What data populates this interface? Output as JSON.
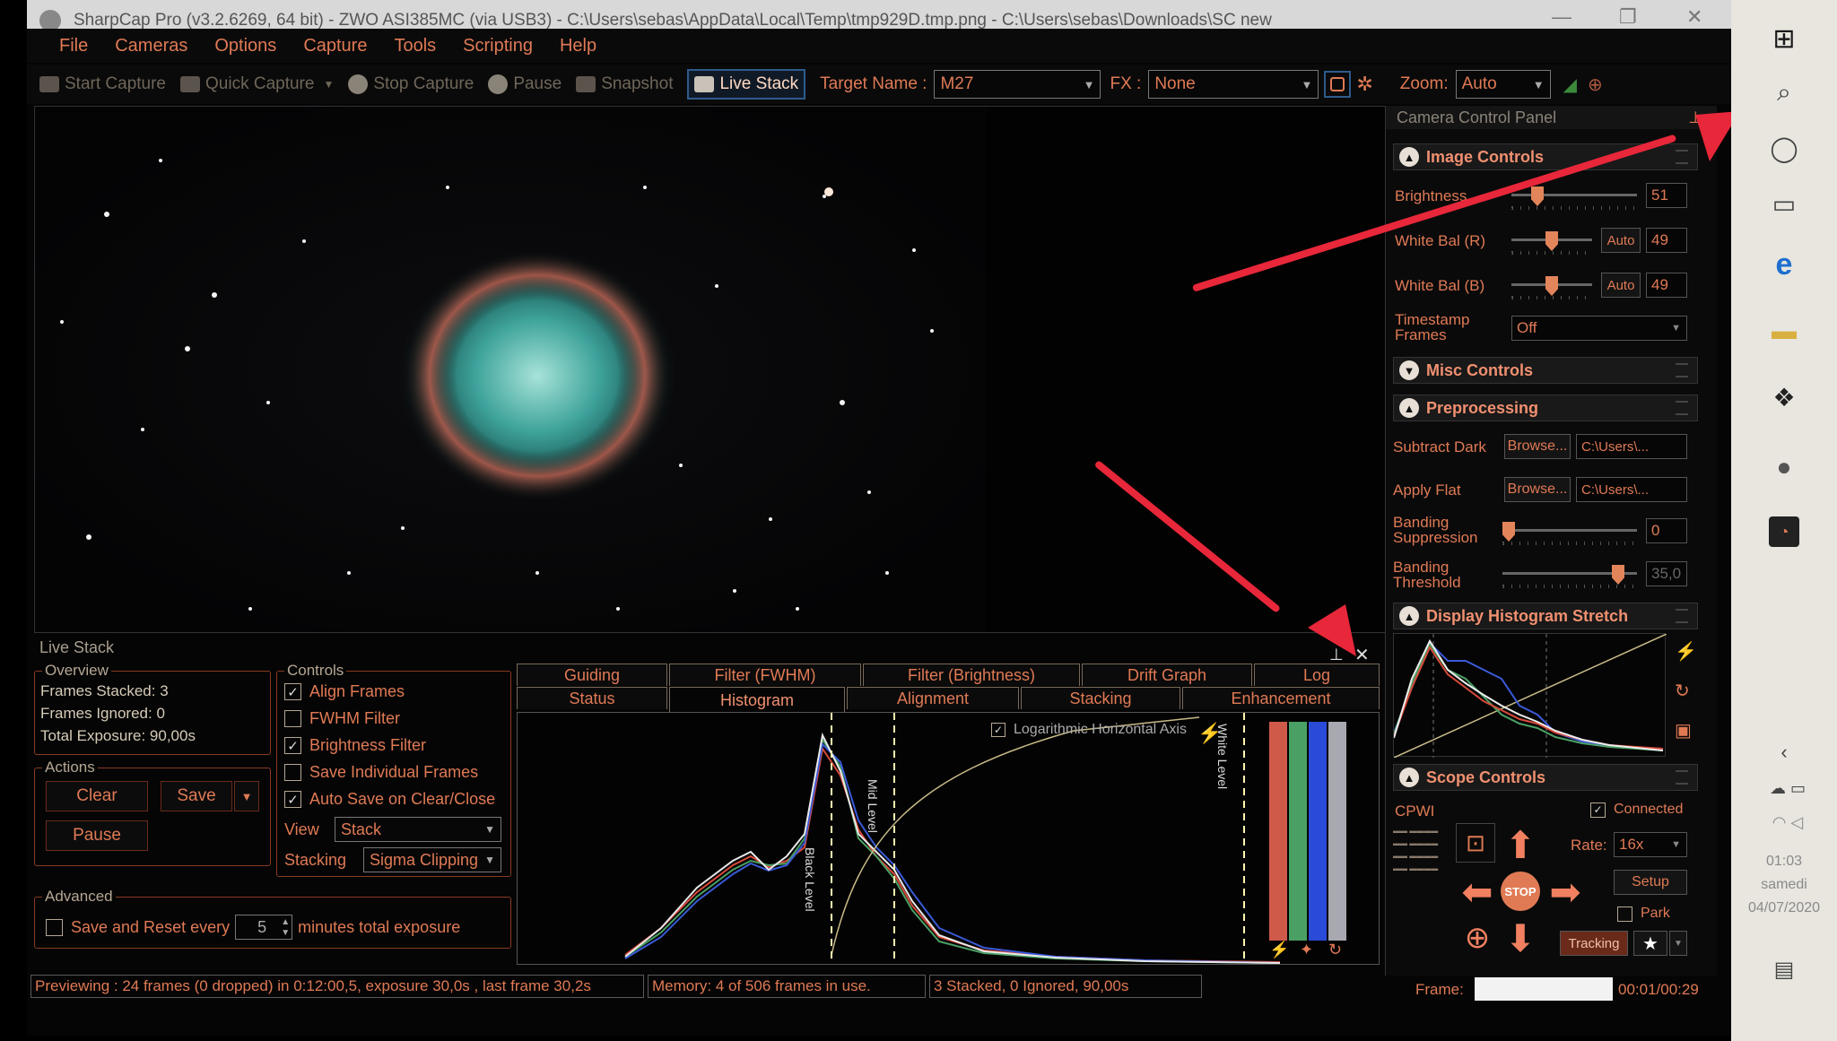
{
  "window": {
    "title": "SharpCap Pro (v3.2.6269, 64 bit) - ZWO ASI385MC (via USB3) - C:\\Users\\sebas\\AppData\\Local\\Temp\\tmp929D.tmp.png - C:\\Users\\sebas\\Downloads\\SC new"
  },
  "menu": [
    "File",
    "Cameras",
    "Options",
    "Capture",
    "Tools",
    "Scripting",
    "Help"
  ],
  "toolbar": {
    "start_capture": "Start Capture",
    "quick_capture": "Quick Capture",
    "stop_capture": "Stop Capture",
    "pause": "Pause",
    "snapshot": "Snapshot",
    "live_stack": "Live Stack",
    "target_label": "Target Name :",
    "target_value": "M27",
    "fx_label": "FX :",
    "fx_value": "None",
    "zoom_label": "Zoom:",
    "zoom_value": "Auto"
  },
  "live_stack": {
    "title": "Live Stack",
    "overview": {
      "label": "Overview",
      "rows": [
        {
          "label": "Frames Stacked:",
          "value": "3"
        },
        {
          "label": "Frames Ignored:",
          "value": "0"
        },
        {
          "label": "Total Exposure:",
          "value": "90,00s"
        }
      ]
    },
    "actions": {
      "label": "Actions",
      "clear": "Clear",
      "save": "Save",
      "pause": "Pause"
    },
    "controls": {
      "label": "Controls",
      "checks": [
        {
          "label": "Align Frames",
          "checked": true
        },
        {
          "label": "FWHM Filter",
          "checked": false
        },
        {
          "label": "Brightness Filter",
          "checked": true
        },
        {
          "label": "Save Individual Frames",
          "checked": false
        },
        {
          "label": "Auto Save on Clear/Close",
          "checked": true
        }
      ],
      "view_label": "View",
      "view_value": "Stack",
      "stacking_label": "Stacking",
      "stacking_value": "Sigma Clipping"
    },
    "advanced": {
      "label": "Advanced",
      "save_reset_label": "Save and Reset every",
      "minutes_value": "5",
      "minutes_suffix": "minutes total exposure"
    }
  },
  "tabs_row1": [
    "Guiding",
    "Filter (FWHM)",
    "Filter (Brightness)",
    "Drift Graph",
    "Log"
  ],
  "tabs_row2": [
    "Status",
    "Histogram",
    "Alignment",
    "Stacking",
    "Enhancement"
  ],
  "histogram": {
    "log_axis_label": "Logarithmic Horizontal Axis",
    "black_level": "Black Level",
    "mid_level": "Mid Level",
    "white_level": "White Level"
  },
  "camera_panel": {
    "title": "Camera Control Panel",
    "image_controls": {
      "title": "Image Controls",
      "brightness_label": "Brightness",
      "brightness_value": "51",
      "wb_r_label": "White Bal (R)",
      "wb_r_value": "49",
      "wb_b_label": "White Bal (B)",
      "wb_b_value": "49",
      "auto": "Auto",
      "timestamp_label": "Timestamp Frames",
      "timestamp_value": "Off"
    },
    "misc_controls": {
      "title": "Misc Controls"
    },
    "preprocessing": {
      "title": "Preprocessing",
      "subtract_dark_label": "Subtract Dark",
      "apply_flat_label": "Apply Flat",
      "browse": "Browse...",
      "path": "C:\\Users\\...",
      "banding_suppression_label": "Banding Suppression",
      "banding_suppression_value": "0",
      "banding_threshold_label": "Banding Threshold",
      "banding_threshold_value": "35,0"
    },
    "display_histogram": {
      "title": "Display Histogram Stretch"
    },
    "scope_controls": {
      "title": "Scope Controls",
      "mount": "CPWI",
      "connected": "Connected",
      "rate_label": "Rate:",
      "rate_value": "16x",
      "setup": "Setup",
      "park": "Park",
      "stop": "STOP",
      "tracking": "Tracking"
    }
  },
  "status_bar": {
    "previewing": "Previewing : 24 frames (0 dropped) in 0:12:00,5, exposure 30,0s , last frame 30,2s",
    "memory": "Memory: 4 of 506 frames in use.",
    "stacked": "3 Stacked, 0 Ignored, 90,00s",
    "frame_label": "Frame:",
    "frame_time": "00:01/00:29"
  },
  "taskbar": {
    "time": "01:03",
    "day": "samedi",
    "date": "04/07/2020"
  },
  "colors": {
    "accent": "#e07a55",
    "arrow": "#e8273a",
    "series_red": "#d84a3a",
    "series_green": "#4aa064",
    "series_blue": "#3a5ad8",
    "series_white": "#e8e8e8"
  }
}
